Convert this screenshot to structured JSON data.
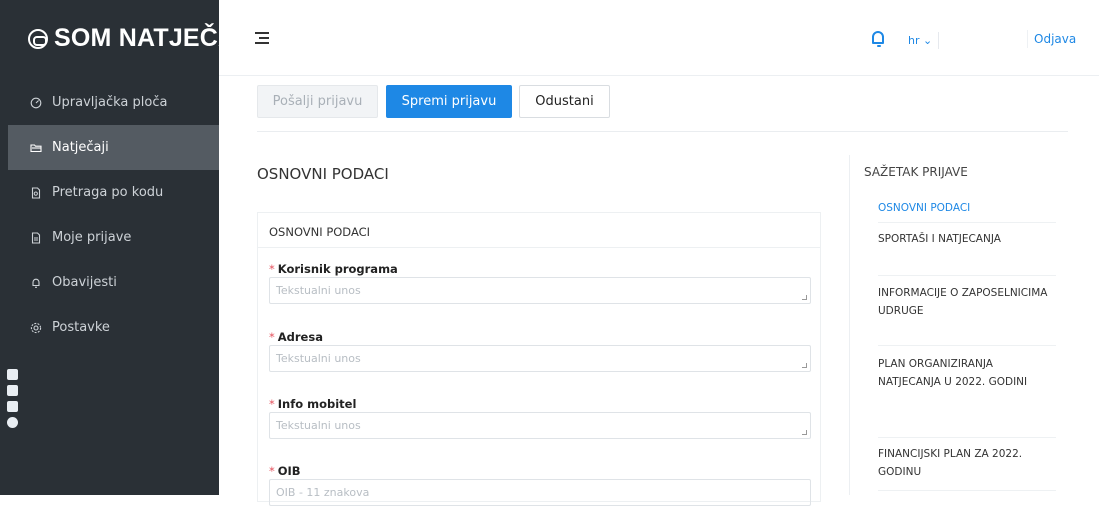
{
  "brand": {
    "name": "SOM NATJEČAJI"
  },
  "sidebar": {
    "items": [
      {
        "label": "Upravljačka ploča",
        "icon": "dashboard-icon"
      },
      {
        "label": "Natječaji",
        "icon": "folder-open-icon",
        "active": true
      },
      {
        "label": "Pretraga po kodu",
        "icon": "document-search-icon"
      },
      {
        "label": "Moje prijave",
        "icon": "document-icon"
      },
      {
        "label": "Obavijesti",
        "icon": "bell-icon"
      },
      {
        "label": "Postavke",
        "icon": "gear-icon"
      }
    ]
  },
  "topbar": {
    "language": "hr ⌄",
    "logout": "Odjava"
  },
  "actions": {
    "send": "Pošalji prijavu",
    "save": "Spremi prijavu",
    "cancel": "Odustani"
  },
  "main": {
    "title": "OSNOVNI PODACI",
    "card_title": "OSNOVNI PODACI",
    "fields": [
      {
        "label": "Korisnik programa",
        "placeholder": "Tekstualni unos"
      },
      {
        "label": "Adresa",
        "placeholder": "Tekstualni unos"
      },
      {
        "label": "Info mobitel",
        "placeholder": "Tekstualni unos"
      },
      {
        "label": "OIB",
        "placeholder": "OIB - 11 znakova"
      }
    ]
  },
  "summary": {
    "title": "SAŽETAK PRIJAVE",
    "items": [
      "OSNOVNI PODACI",
      "SPORTAŠI I NATJECANJA",
      "INFORMACIJE O ZAPOSELNICIMA UDRUGE",
      "PLAN ORGANIZIRANJA NATJECANJA U 2022. GODINI",
      "FINANCIJSKI PLAN ZA 2022. GODINU"
    ]
  },
  "colors": {
    "accent": "#1e88e5",
    "sidebar": "#2a3036",
    "active_nav": "#545b62",
    "required": "#e4505c"
  }
}
